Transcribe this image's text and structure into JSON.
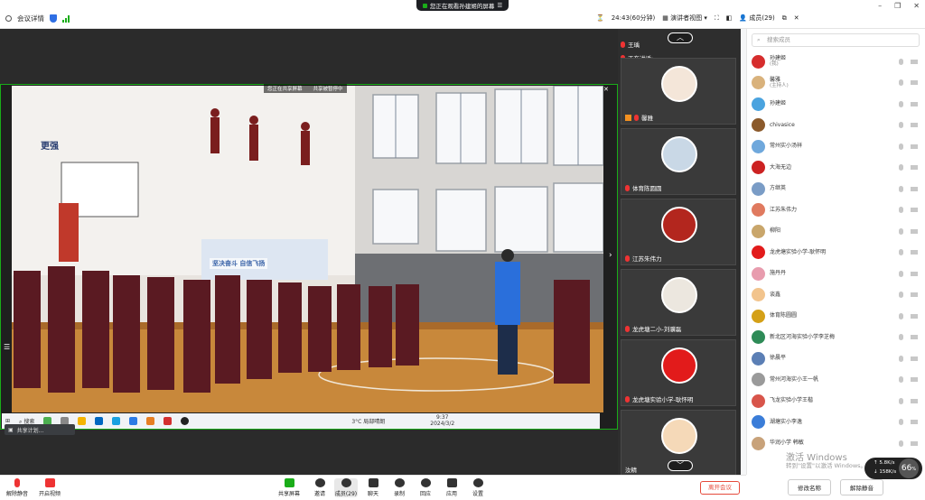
{
  "topbar": {
    "meeting_info": "会议详情",
    "sharing_notice": "您正在观看孙建姬的屏幕",
    "timer": "24:43(60分钟)",
    "view_mode": "演讲者视图",
    "members_label": "成员(29)"
  },
  "stage": {
    "share_tag_left": "您正在共享屏幕",
    "share_tag_right": "共享被暂停中",
    "wall_banner": "坚决奋斗 自信飞扬",
    "slogan_left": "更强",
    "taskbar": {
      "search": "搜索",
      "weather": "3°C 局部晴朗",
      "time": "9:37",
      "date": "2024/3/2"
    },
    "floating_pill": "共享计划..."
  },
  "speaker_strip": {
    "now_speaking_label": "正在讲话:",
    "top_name": "王瑀",
    "tiles": [
      {
        "name": "馨雅"
      },
      {
        "name": "体育陈圆圆"
      },
      {
        "name": "江苏朱伟力"
      },
      {
        "name": "龙虎塘二小-刘骥磊"
      },
      {
        "name": "龙虎塘实验小学-耿怀明"
      },
      {
        "name": "汝精"
      }
    ]
  },
  "panel": {
    "search_placeholder": "搜索成员",
    "members": [
      {
        "name": "孙建姬",
        "sub": "(我)",
        "color": "#d62d2d"
      },
      {
        "name": "馨雅",
        "sub": "(主持人)",
        "color": "#d9b27c"
      },
      {
        "name": "孙建姬",
        "sub": "",
        "color": "#4aa3df"
      },
      {
        "name": "chivasice",
        "sub": "",
        "color": "#8b5a2b"
      },
      {
        "name": "常州实小汤祥",
        "sub": "",
        "color": "#6fa8dc"
      },
      {
        "name": "大海无边",
        "sub": "",
        "color": "#cc2222"
      },
      {
        "name": "方继英",
        "sub": "",
        "color": "#7a9cc6"
      },
      {
        "name": "江苏朱伟力",
        "sub": "",
        "color": "#e07a5f"
      },
      {
        "name": "柳阳",
        "sub": "",
        "color": "#c9a66b"
      },
      {
        "name": "龙虎塘实验小学-耿怀明",
        "sub": "",
        "color": "#e21b1b"
      },
      {
        "name": "施丹丹",
        "sub": "",
        "color": "#e89cae"
      },
      {
        "name": "谈鑫",
        "sub": "",
        "color": "#f2c48d"
      },
      {
        "name": "体育陈圆圆",
        "sub": "",
        "color": "#d4a017"
      },
      {
        "name": "新北区河海实验小学李芝梅",
        "sub": "",
        "color": "#2e8b57"
      },
      {
        "name": "徐晨平",
        "sub": "",
        "color": "#5b7fb5"
      },
      {
        "name": "常州河海实小王一帆",
        "sub": "",
        "color": "#9a9a9a"
      },
      {
        "name": "飞龙实验小学王楷",
        "sub": "",
        "color": "#d8554b"
      },
      {
        "name": "湖塘实小李逸",
        "sub": "",
        "color": "#3b7dd8"
      },
      {
        "name": "华润小学 韩敏",
        "sub": "",
        "color": "#c8a27a"
      }
    ],
    "btn_rename": "修改名称",
    "btn_unmute_all": "解除静音"
  },
  "toolbar": {
    "unmute": "解除静音",
    "start_video": "开启视频",
    "share_screen": "共享屏幕",
    "invite": "邀请",
    "members": "成员(29)",
    "chat": "聊天",
    "record": "录制",
    "reaction": "回应",
    "apps": "应用",
    "settings": "设置",
    "leave": "离开会议"
  },
  "overlay": {
    "speed_up": "5.8",
    "speed_down": "158",
    "speed_unit": "K/s",
    "percent": "66",
    "watermark_title": "激活 Windows",
    "watermark_sub": "转到\"设置\"以激活 Windows。"
  }
}
